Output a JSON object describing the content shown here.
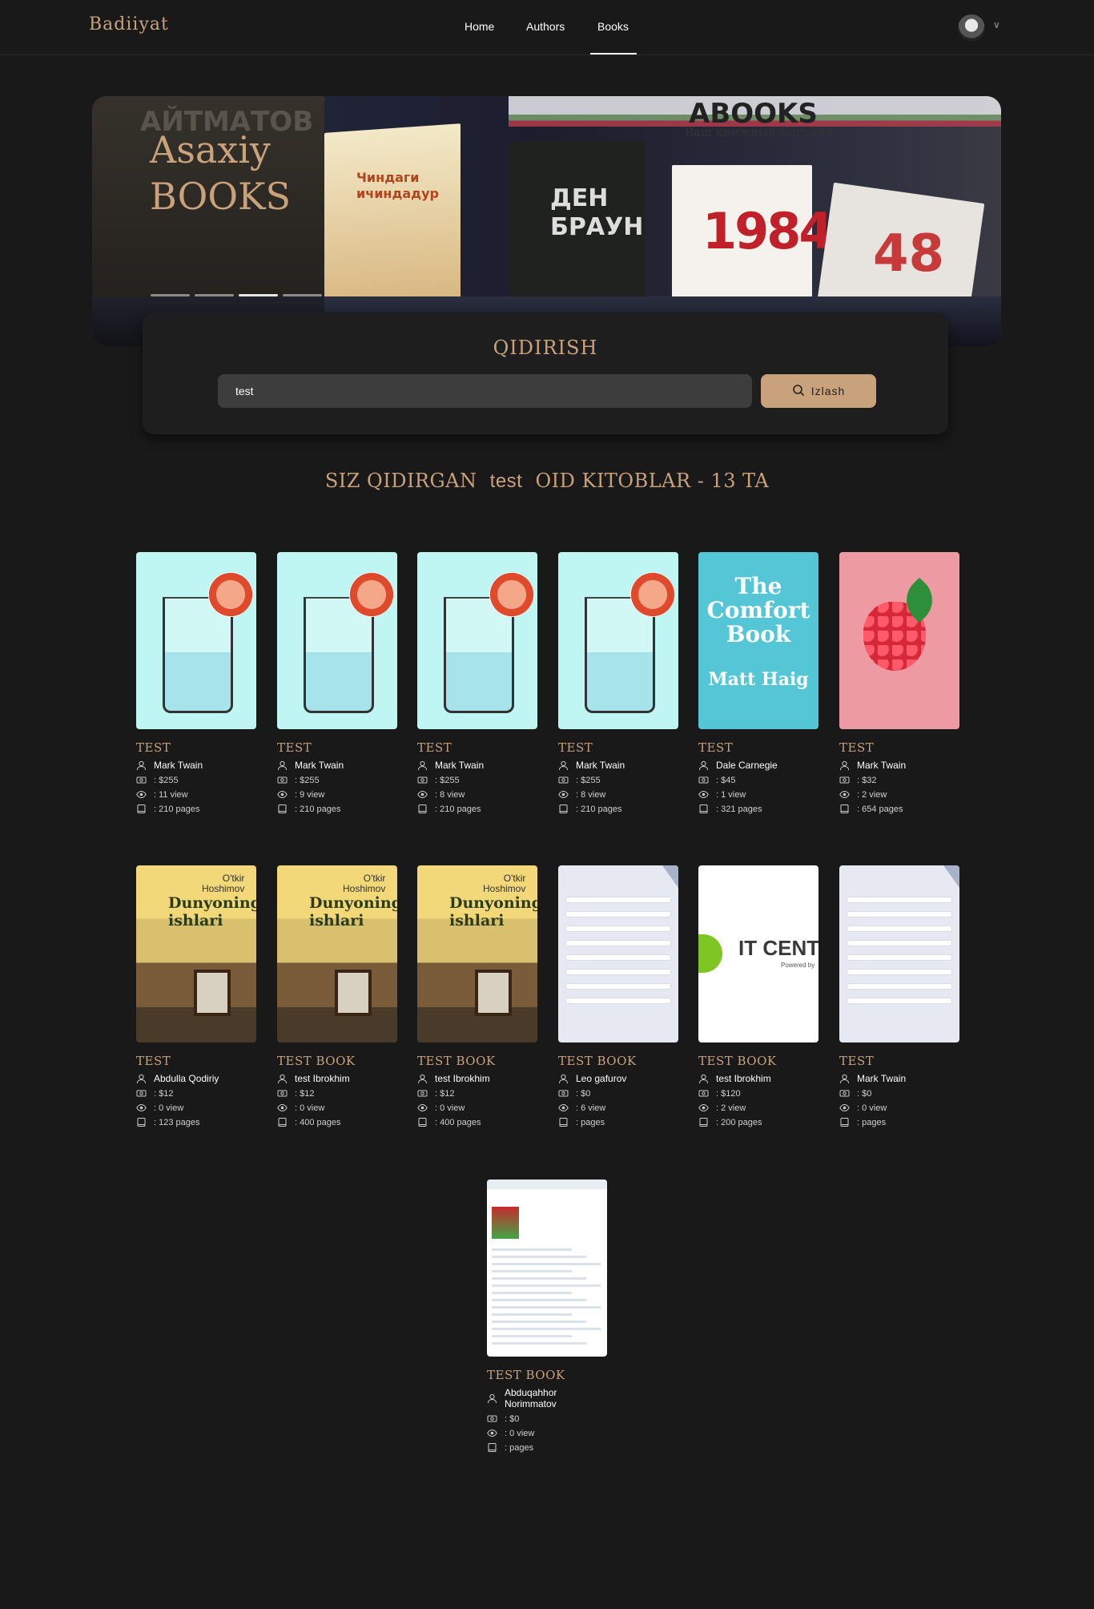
{
  "header": {
    "logo": "Badiiyat",
    "nav": [
      {
        "label": "Home"
      },
      {
        "label": "Authors"
      },
      {
        "label": "Books",
        "active": true
      }
    ],
    "user_icon": "avatar",
    "dropdown_icon": "chevron-down-icon"
  },
  "hero": {
    "title_line1": "Asaxiy",
    "title_line2": "books",
    "carousel": {
      "slides": 4,
      "active_index": 2
    },
    "photo_text": {
      "abooks": "ABOOKS",
      "abooks_sub": "Ваш книжный магазин",
      "book_brown": "ДЕН\nБРАУН",
      "book_1984": "1984",
      "book_48": "48",
      "book_chin": "Чиндаги\nичиндадур",
      "aitmatov": "АЙТМАТОВ"
    }
  },
  "search": {
    "title": "Qidirish",
    "input_value": "test",
    "button_label": "Izlash"
  },
  "results": {
    "heading_prefix": "Siz qidirgan",
    "query": "test",
    "heading_suffix": "oid kitoblar - 13 ta"
  },
  "books": [
    {
      "title": "Test",
      "author": "Mark Twain",
      "price": ": $255",
      "views": ": 11 view",
      "pages": ": 210 pages",
      "cover": "glass"
    },
    {
      "title": "Test",
      "author": "Mark Twain",
      "price": ": $255",
      "views": ": 9 view",
      "pages": ": 210 pages",
      "cover": "glass"
    },
    {
      "title": "Test",
      "author": "Mark Twain",
      "price": ": $255",
      "views": ": 8 view",
      "pages": ": 210 pages",
      "cover": "glass"
    },
    {
      "title": "Test",
      "author": "Mark Twain",
      "price": ": $255",
      "views": ": 8 view",
      "pages": ": 210 pages",
      "cover": "glass"
    },
    {
      "title": "Test",
      "author": "Dale Carnegie",
      "price": ": $45",
      "views": ": 1 view",
      "pages": ": 321 pages",
      "cover": "comfort",
      "cover_text": {
        "t1": "The",
        "t2": "Comfort",
        "t3": "Book",
        "t4": "Matt Haig"
      }
    },
    {
      "title": "Test",
      "author": "Mark Twain",
      "price": ": $32",
      "views": ": 2 view",
      "pages": ": 654 pages",
      "cover": "raspberry"
    },
    {
      "title": "Test",
      "author": "Abdulla Qodiriy",
      "price": ": $12",
      "views": ": 0 view",
      "pages": ": 123 pages",
      "cover": "uzb",
      "cover_text": {
        "author": "O'tkir\nHoshimov",
        "t1": "Dunyoning\nishlari"
      }
    },
    {
      "title": "Test book",
      "author": "test Ibrokhim",
      "price": ": $12",
      "views": ": 0 view",
      "pages": ": 400 pages",
      "cover": "uzb",
      "cover_text": {
        "author": "O'tkir\nHoshimov",
        "t1": "Dunyoning\nishlari"
      }
    },
    {
      "title": "Test book",
      "author": "test Ibrokhim",
      "price": ": $12",
      "views": ": 0 view",
      "pages": ": 400 pages",
      "cover": "uzb",
      "cover_text": {
        "author": "O'tkir\nHoshimov",
        "t1": "Dunyoning\nishlari"
      }
    },
    {
      "title": "Test book",
      "author": "Leo gafurov",
      "price": ": $0",
      "views": ": 6 view",
      "pages": ": pages",
      "cover": "web"
    },
    {
      "title": "Test book",
      "author": "test Ibrokhim",
      "price": ": $120",
      "views": ": 2 view",
      "pages": ": 200 pages",
      "cover": "it",
      "cover_text": {
        "t1": "IT CENTE",
        "t2": "Powered by"
      }
    },
    {
      "title": "Test",
      "author": "Mark Twain",
      "price": ": $0",
      "views": ": 0 view",
      "pages": ": pages",
      "cover": "web"
    },
    {
      "title": "Test book",
      "author": "Abduqahhor Norimmatov",
      "price": ": $0",
      "views": ": 0 view",
      "pages": ": pages",
      "cover": "shop"
    }
  ],
  "icons": {
    "author": "user-icon",
    "price": "money-icon",
    "views": "eye-icon",
    "pages": "book-icon",
    "search": "search-icon"
  },
  "colors": {
    "background": "#191919",
    "accent": "#c9a27c",
    "input_bg": "#3d3d3d"
  }
}
